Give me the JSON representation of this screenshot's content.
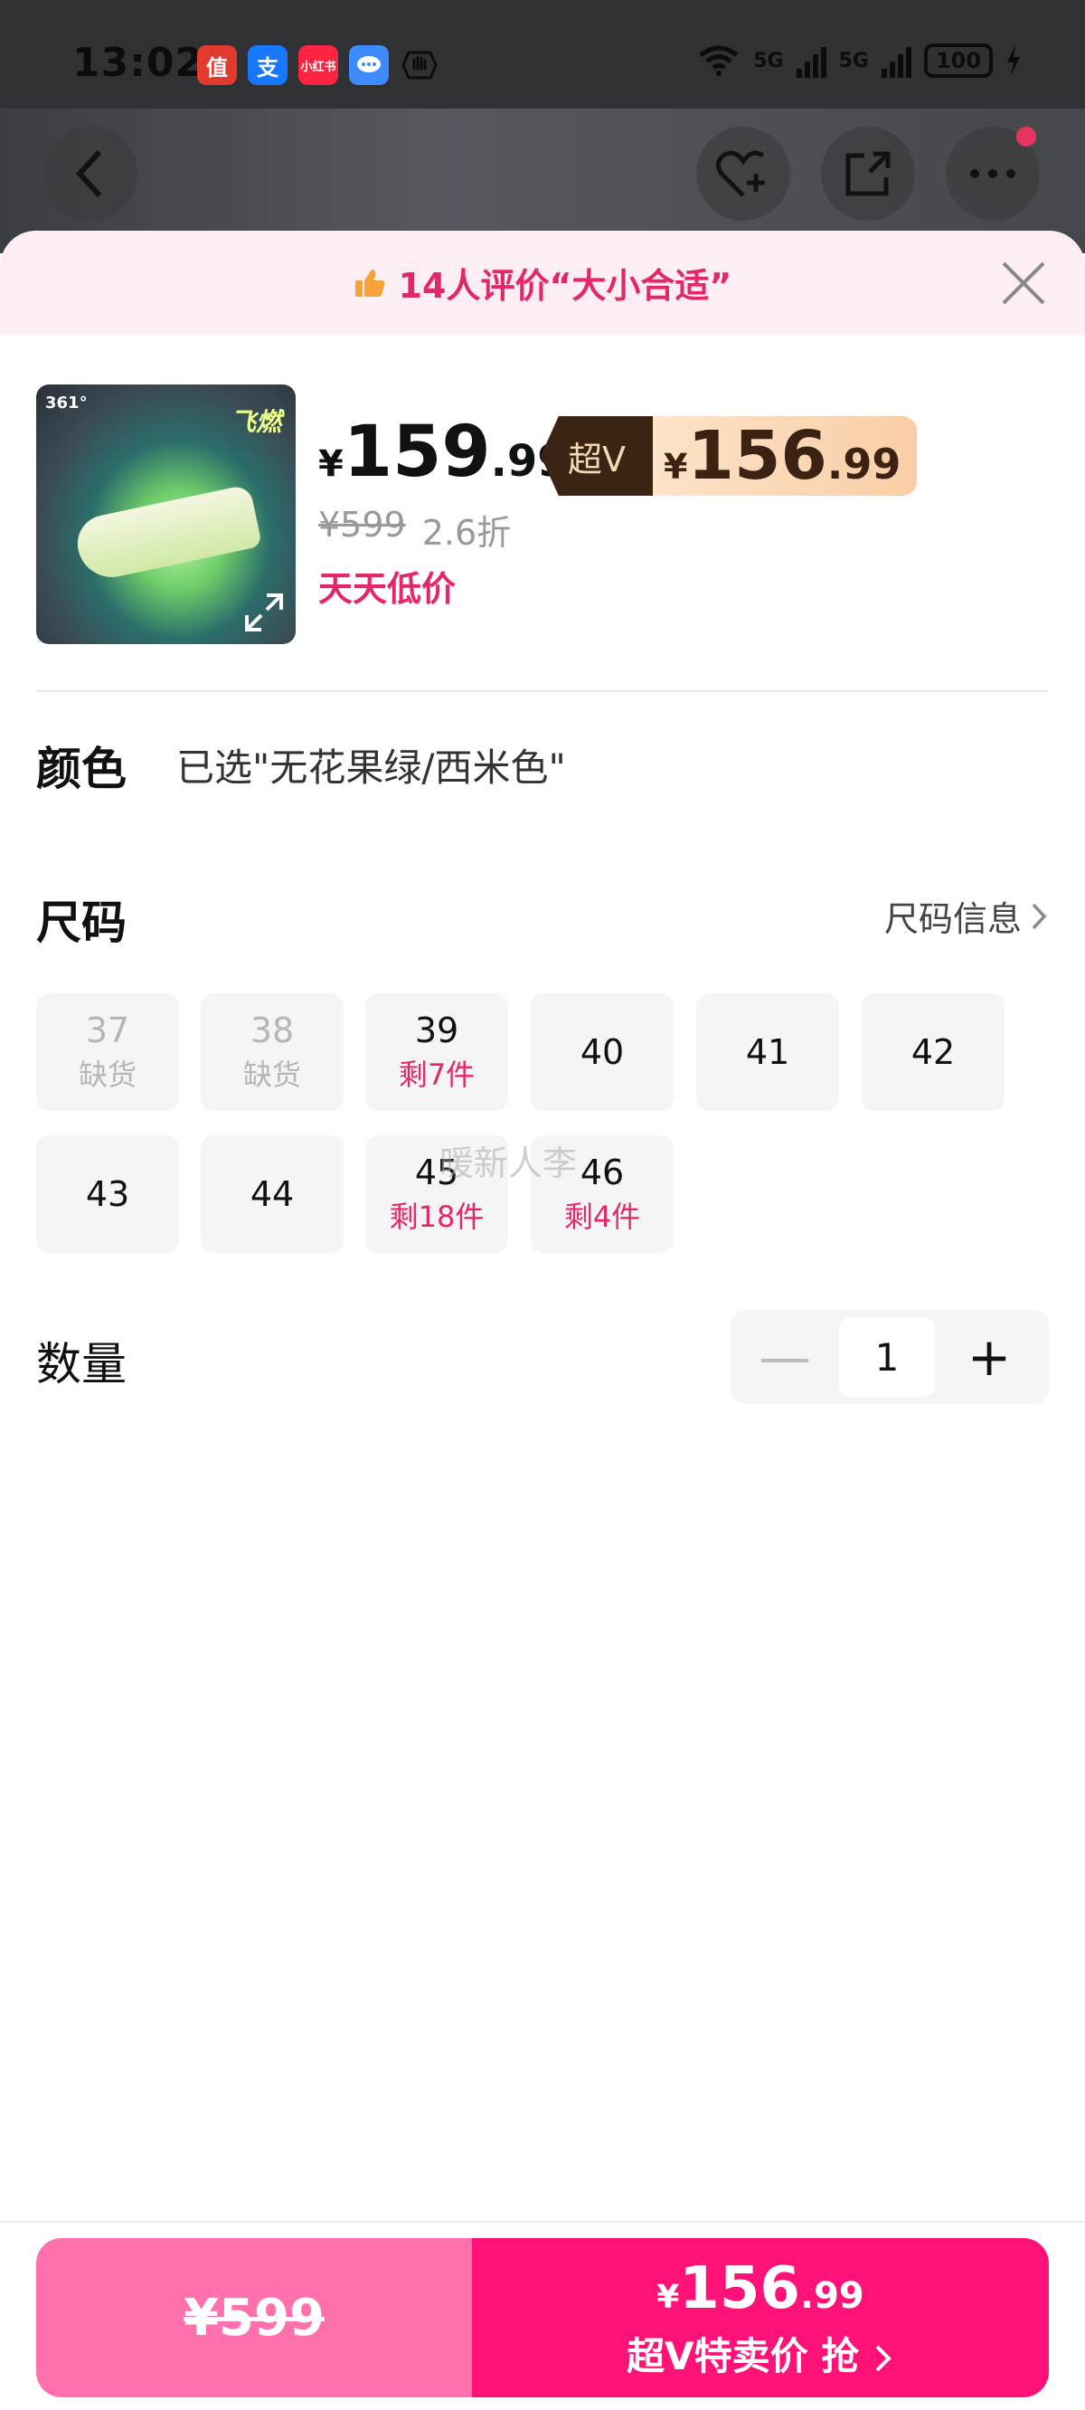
{
  "status_bar": {
    "time": "13:02",
    "apps": [
      {
        "name": "值",
        "color": "#e23b2e"
      },
      {
        "name": "支",
        "color": "#1677ff"
      },
      {
        "name": "小红书",
        "color": "#ff2442"
      },
      {
        "name": "chat",
        "color": "#3d8bff"
      }
    ],
    "net1": "5G",
    "net2": "5G",
    "battery": "100"
  },
  "banner": {
    "text": "14人评价“大小合适”"
  },
  "product": {
    "image_logo": "361°",
    "image_brand": "飞燃",
    "price_symbol": "¥",
    "price_int": "159",
    "price_dec": ".99",
    "svip_tag": "超V",
    "svip_symbol": "¥",
    "svip_int": "156",
    "svip_dec": ".99",
    "original_price": "¥599",
    "discount": "2.6折",
    "promo": "天天低价"
  },
  "color_section": {
    "label": "颜色",
    "value": "已选\"无花果绿/西米色\""
  },
  "size_section": {
    "label": "尺码",
    "info_link": "尺码信息",
    "sizes": [
      {
        "num": "37",
        "sub": "缺货",
        "out": true
      },
      {
        "num": "38",
        "sub": "缺货",
        "out": true
      },
      {
        "num": "39",
        "sub": "剩7件",
        "out": false
      },
      {
        "num": "40",
        "sub": "",
        "out": false
      },
      {
        "num": "41",
        "sub": "",
        "out": false
      },
      {
        "num": "42",
        "sub": "",
        "out": false
      },
      {
        "num": "43",
        "sub": "",
        "out": false
      },
      {
        "num": "44",
        "sub": "",
        "out": false
      },
      {
        "num": "45",
        "sub": "剩18件",
        "out": false
      },
      {
        "num": "46",
        "sub": "剩4件",
        "out": false
      }
    ],
    "watermark": "暖新人李"
  },
  "quantity_section": {
    "label": "数量",
    "value": "1",
    "minus": "—",
    "plus": "+"
  },
  "bottom": {
    "left_price": "¥599",
    "right_symbol": "¥",
    "right_int": "156",
    "right_dec": ".99",
    "right_label": "超V特卖价 抢"
  },
  "colors": {
    "accent": "#e4276b",
    "buy_button": "#ff1277",
    "left_button": "#ff71ad",
    "banner_bg": "#fdeef3"
  }
}
